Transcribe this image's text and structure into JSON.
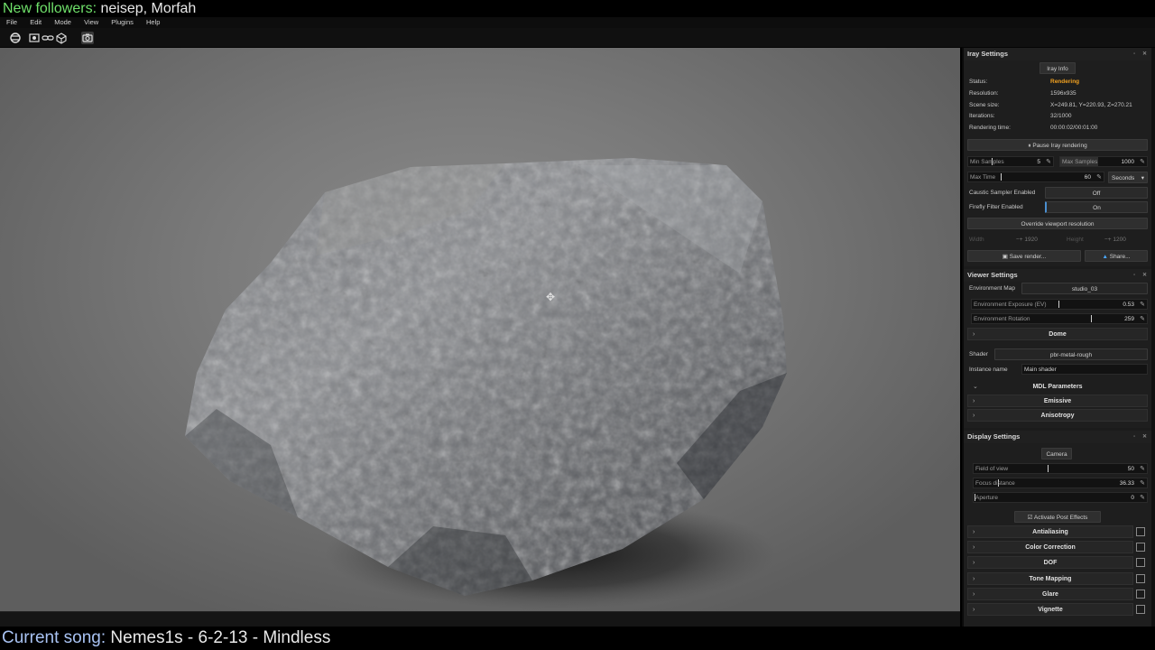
{
  "overlay": {
    "followers_label": "New followers:",
    "followers_value": "neisep, Morfah",
    "song_label": "Current song:",
    "song_value": "Nemes1s - 6-2-13 - Mindless"
  },
  "menu": [
    "File",
    "Edit",
    "Mode",
    "View",
    "Plugins",
    "Help"
  ],
  "toolbar_icons": [
    "render-icon",
    "render-region-icon",
    "link-icon",
    "cube-icon",
    "camera-icon"
  ],
  "iray": {
    "title": "Iray Settings",
    "info_tab": "Iray Info",
    "rows": [
      {
        "key": "Status:",
        "value": "Rendering"
      },
      {
        "key": "Resolution:",
        "value": "1596x935"
      },
      {
        "key": "Scene size:",
        "value": "X=249.81, Y=220.93, Z=270.21"
      },
      {
        "key": "Iterations:",
        "value": "32/1000"
      },
      {
        "key": "Rendering time:",
        "value": "00:00:02/00:01:00"
      }
    ],
    "pause_button": "Pause Iray rendering",
    "min_samples_label": "Min Samples",
    "min_samples_value": "5",
    "max_samples_label": "Max Samples",
    "max_samples_value": "1000",
    "max_time_label": "Max Time",
    "max_time_value": "60",
    "time_unit": "Seconds",
    "caustic_label": "Caustic Sampler Enabled",
    "caustic_value": "Off",
    "firefly_label": "Firefly Filter Enabled",
    "firefly_value": "On",
    "override_button": "Override viewport resolution",
    "width_label": "Width",
    "width_value": "1920",
    "height_label": "Height",
    "height_value": "1200",
    "save_button": "Save render...",
    "share_button": "Share..."
  },
  "viewer": {
    "title": "Viewer Settings",
    "env_map_label": "Environment Map",
    "env_map_value": "studio_03",
    "exposure_label": "Environment Exposure (EV)",
    "exposure_value": "0.53",
    "rotation_label": "Environment Rotation",
    "rotation_value": "259",
    "dome_group": "Dome",
    "shader_label": "Shader",
    "shader_value": "pbr-metal-rough",
    "instance_label": "Instance name",
    "instance_value": "Main shader",
    "mdl_group": "MDL Parameters",
    "emissive_group": "Emissive",
    "anisotropy_group": "Anisotropy"
  },
  "display": {
    "title": "Display Settings",
    "camera_tab": "Camera",
    "fov_label": "Field of view",
    "fov_value": "50",
    "focus_label": "Focus distance",
    "focus_value": "36.33",
    "aperture_label": "Aperture",
    "aperture_value": "0",
    "post_effects_label": "Activate Post Effects",
    "groups": [
      "Antialiasing",
      "Color Correction",
      "DOF",
      "Tone Mapping",
      "Glare",
      "Vignette"
    ]
  }
}
